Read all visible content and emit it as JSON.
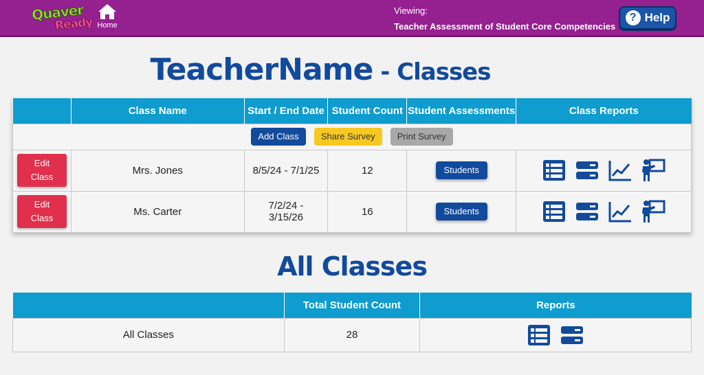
{
  "header": {
    "logo_line1": "Quaver",
    "logo_line2": "Ready",
    "home_label": "Home",
    "viewing_label": "Viewing:",
    "viewing_title": "Teacher Assessment of Student Core Competencies",
    "help_label": "Help",
    "help_icon": "?"
  },
  "page": {
    "title_name": "TeacherName",
    "title_suffix": " - Classes",
    "all_classes_title": "All Classes"
  },
  "classes_table": {
    "headers": [
      "",
      "Class Name",
      "Start / End Date",
      "Student Count",
      "Student Assessments",
      "Class Reports"
    ],
    "add_class_label": "Add Class",
    "share_survey_label": "Share Survey",
    "print_survey_label": "Print Survey",
    "rows": [
      {
        "edit_label_1": "Edit",
        "edit_label_2": "Class",
        "name": "Mrs. Jones",
        "dates_1": "8/5/24 - 7/1/25",
        "dates_2": "",
        "count": "12",
        "students_label": "Students"
      },
      {
        "edit_label_1": "Edit",
        "edit_label_2": "Class",
        "name": "Ms. Carter",
        "dates_1": "7/2/24 -",
        "dates_2": "3/15/26",
        "count": "16",
        "students_label": "Students"
      }
    ],
    "report_icons": [
      "table-report-icon",
      "list-report-icon",
      "line-chart-icon",
      "teacher-presentation-icon"
    ]
  },
  "all_classes_table": {
    "headers": [
      "",
      "Total Student Count",
      "Reports"
    ],
    "row": {
      "name": "All Classes",
      "count": "28"
    },
    "report_icons": [
      "table-report-icon",
      "list-report-icon"
    ]
  },
  "colors": {
    "topbar": "#952090",
    "header_cell": "#0f9ccf",
    "primary_blue": "#124a9c",
    "edit_red": "#e0304d",
    "share_yellow": "#f7c81f",
    "print_gray": "#a8a8a8"
  }
}
